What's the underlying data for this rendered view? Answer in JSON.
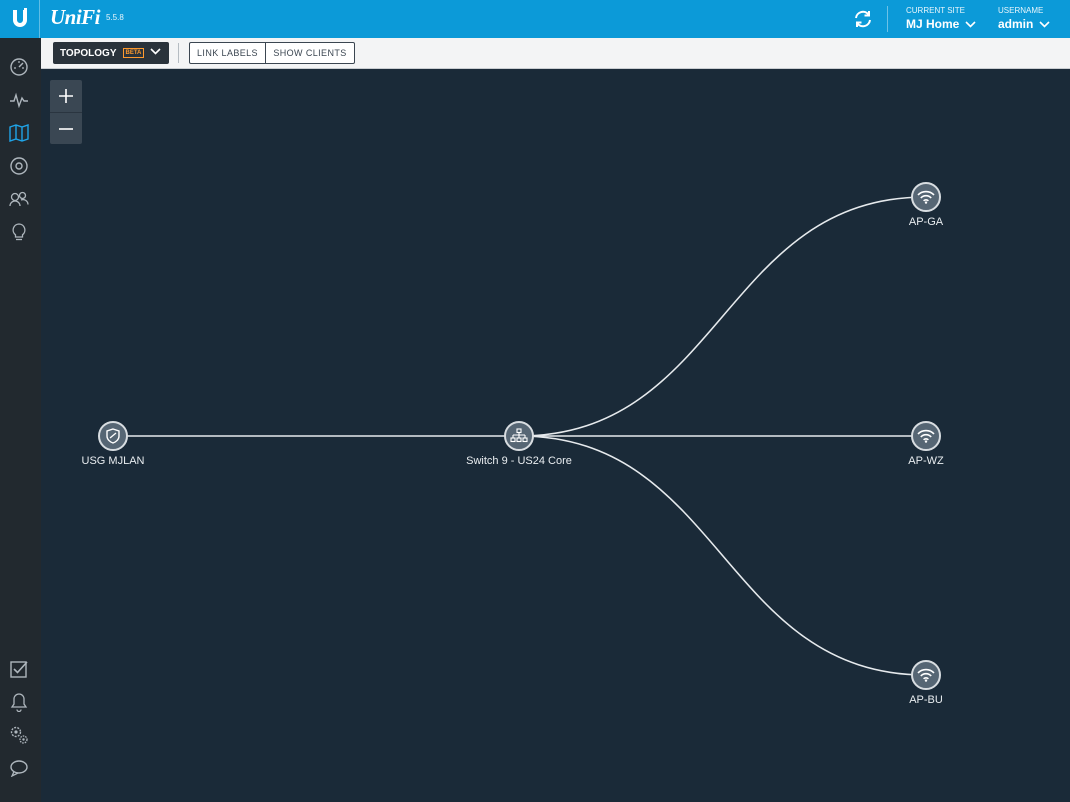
{
  "header": {
    "brand": "UniFi",
    "version": "5.5.8",
    "site_label": "CURRENT SITE",
    "site_value": "MJ Home",
    "user_label": "USERNAME",
    "user_value": "admin",
    "accent_color": "#0c9ad8"
  },
  "sidebar": {
    "top_items": [
      {
        "name": "dashboard",
        "icon": "dashboard-icon"
      },
      {
        "name": "statistics",
        "icon": "pulse-icon"
      },
      {
        "name": "map",
        "icon": "map-icon",
        "active": true
      },
      {
        "name": "devices",
        "icon": "devices-icon"
      },
      {
        "name": "clients",
        "icon": "clients-icon"
      },
      {
        "name": "insights",
        "icon": "lightbulb-icon"
      }
    ],
    "bottom_items": [
      {
        "name": "events",
        "icon": "checkbox-icon"
      },
      {
        "name": "alerts",
        "icon": "bell-icon"
      },
      {
        "name": "settings",
        "icon": "gears-icon"
      },
      {
        "name": "chat",
        "icon": "chat-icon"
      }
    ]
  },
  "toolbar": {
    "view_label": "TOPOLOGY",
    "beta_label": "BETA",
    "link_labels": "LINK LABELS",
    "show_clients": "SHOW CLIENTS"
  },
  "map": {
    "zoom_in": "+",
    "zoom_out": "−"
  },
  "topology": {
    "nodes": [
      {
        "id": "usg",
        "label": "USG MJLAN",
        "type": "gateway"
      },
      {
        "id": "switch",
        "label": "Switch 9 - US24 Core",
        "type": "switch"
      },
      {
        "id": "ap-ga",
        "label": "AP-GA",
        "type": "ap"
      },
      {
        "id": "ap-wz",
        "label": "AP-WZ",
        "type": "ap"
      },
      {
        "id": "ap-bu",
        "label": "AP-BU",
        "type": "ap"
      }
    ],
    "links": [
      [
        "usg",
        "switch"
      ],
      [
        "switch",
        "ap-ga"
      ],
      [
        "switch",
        "ap-wz"
      ],
      [
        "switch",
        "ap-bu"
      ]
    ]
  }
}
